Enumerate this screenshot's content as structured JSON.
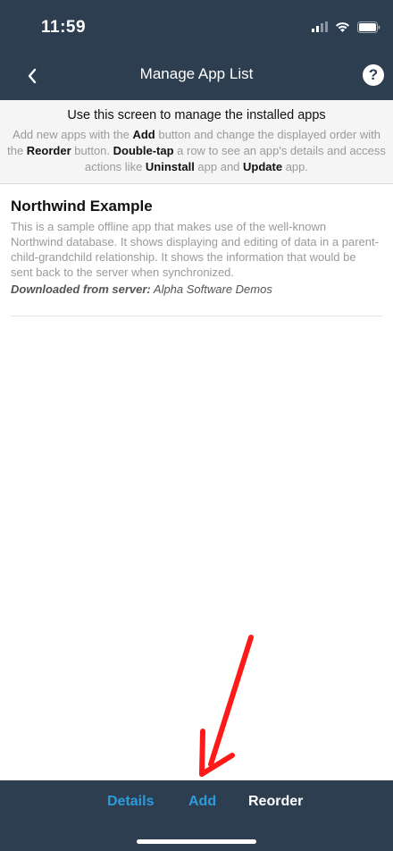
{
  "status_bar": {
    "time": "11:59"
  },
  "nav": {
    "title": "Manage App List",
    "help_label": "?"
  },
  "intro": {
    "heading": "Use this screen to manage the installed apps",
    "line1_a": "Add new apps with the ",
    "line1_b": "Add",
    "line1_c": " button and change the displayed order with the ",
    "line1_d": "Reorder",
    "line1_e": " button. ",
    "line1_f": "Double-tap",
    "line1_g": " a row to see an app's details and access actions like ",
    "line1_h": "Uninstall",
    "line1_i": " app and ",
    "line1_j": "Update",
    "line1_k": " app."
  },
  "apps": [
    {
      "title": "Northwind Example",
      "description": "This is a sample offline app that makes use of the well-known Northwind database. It shows displaying and editing of data in a parent-child-grandchild relationship. It shows the information that would be sent back to the server when synchronized.",
      "source_label": "Downloaded from server:",
      "source_value": " Alpha Software Demos"
    }
  ],
  "toolbar": {
    "details": "Details",
    "add": "Add",
    "reorder": "Reorder"
  },
  "colors": {
    "bar": "#2c3e50",
    "accent": "#2d9cdb",
    "arrow": "#ff1a1a"
  },
  "icons": [
    "signal-icon",
    "wifi-icon",
    "battery-icon",
    "back-chevron-icon",
    "help-icon"
  ]
}
